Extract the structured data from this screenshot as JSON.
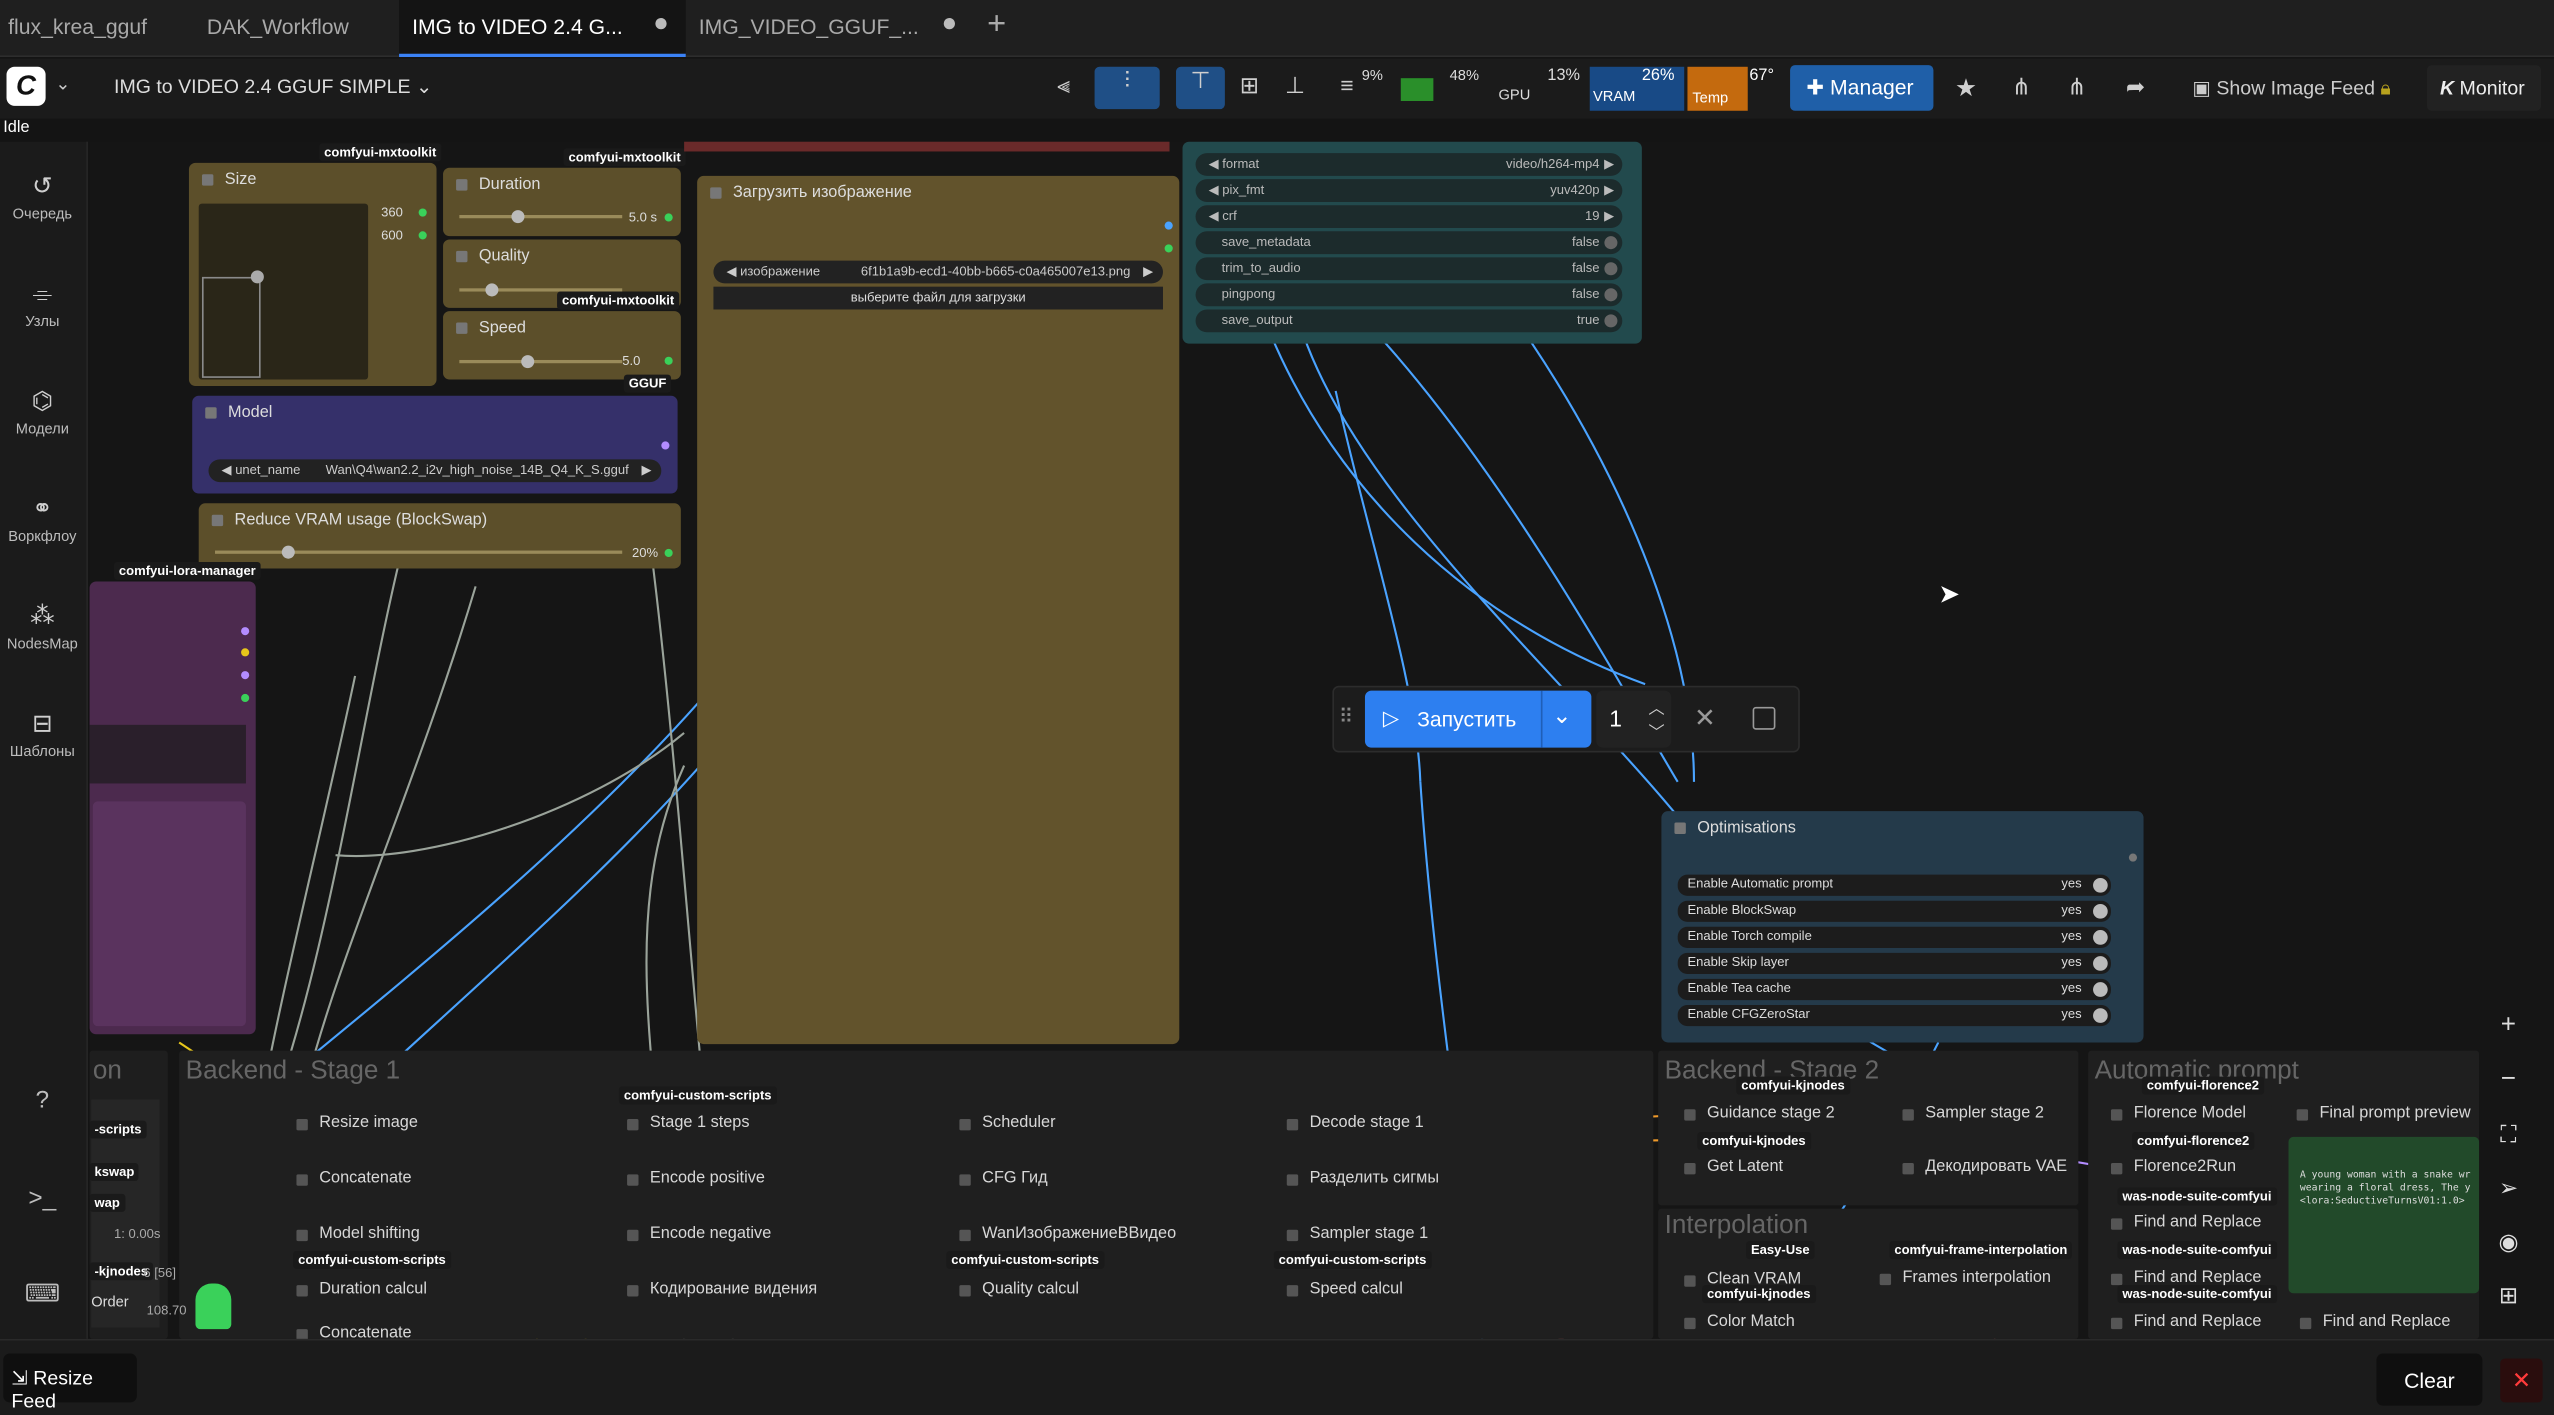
{
  "tabs": [
    {
      "label": "flux_krea_gguf"
    },
    {
      "label": "DAK_Workflow"
    },
    {
      "label": "IMG to VIDEO 2.4 G...",
      "active": true
    },
    {
      "label": "IMG_VIDEO_GGUF_..."
    }
  ],
  "menubar": {
    "workflow_name": "IMG to VIDEO 2.4 GGUF SIMPLE",
    "stats": {
      "cpu": "9%",
      "ram": "48%",
      "gpu_label": "GPU",
      "gpu": "13%",
      "vram_label": "VRAM",
      "vram": "26%",
      "temp_label": "Temp",
      "temp": "67°"
    },
    "manager_label": "Manager",
    "show_image_feed": "Show Image Feed",
    "monitor_label": "Monitor"
  },
  "status": "Idle",
  "sidebar": [
    {
      "label": "Очередь",
      "icon": "history-icon"
    },
    {
      "label": "Узлы",
      "icon": "nodes-icon"
    },
    {
      "label": "Модели",
      "icon": "models-icon"
    },
    {
      "label": "Воркфлоу",
      "icon": "workflow-icon"
    },
    {
      "label": "NodesMap",
      "icon": "nodesmap-icon"
    },
    {
      "label": "Шаблоны",
      "icon": "templates-icon"
    }
  ],
  "nodes": {
    "size": {
      "title": "Size",
      "w": "360",
      "h": "600",
      "tag": "comfyui-mxtoolkit"
    },
    "duration": {
      "title": "Duration",
      "value": "5.0 s",
      "tag": "comfyui-mxtoolkit"
    },
    "quality": {
      "title": "Quality",
      "tag": "comfyui-mxtoolkit"
    },
    "speed": {
      "title": "Speed",
      "value": "5.0",
      "tag": "GGUF"
    },
    "model": {
      "title": "Model",
      "unet_label": "unet_name",
      "unet_value": "Wan\\Q4\\wan2.2_i2v_high_noise_14B_Q4_K_S.gguf"
    },
    "blockswap": {
      "title": "Reduce VRAM usage (BlockSwap)",
      "value": "20%"
    },
    "lora_tag": "comfyui-lora-manager",
    "load_image": {
      "title": "Загрузить изображение",
      "image_label": "изображение",
      "image_value": "6f1b1a9b-ecd1-40bb-b665-c0a465007e13.png",
      "upload_label": "выберите файл для загрузки"
    },
    "video": {
      "widgets": [
        {
          "label": "format",
          "value": "video/h264-mp4",
          "arrows": true
        },
        {
          "label": "pix_fmt",
          "value": "yuv420p",
          "arrows": true
        },
        {
          "label": "crf",
          "value": "19",
          "arrows": true
        },
        {
          "label": "save_metadata",
          "value": "false"
        },
        {
          "label": "trim_to_audio",
          "value": "false"
        },
        {
          "label": "pingpong",
          "value": "false"
        },
        {
          "label": "save_output",
          "value": "true"
        }
      ]
    },
    "optimisations": {
      "title": "Optimisations",
      "items": [
        {
          "label": "Enable Automatic prompt",
          "value": "yes"
        },
        {
          "label": "Enable BlockSwap",
          "value": "yes"
        },
        {
          "label": "Enable Torch compile",
          "value": "yes"
        },
        {
          "label": "Enable Skip layer",
          "value": "yes"
        },
        {
          "label": "Enable Tea cache",
          "value": "yes"
        },
        {
          "label": "Enable CFGZeroStar",
          "value": "yes"
        }
      ]
    }
  },
  "run": {
    "label": "Запустить",
    "count": "1"
  },
  "groups": {
    "stage1": "Backend - Stage 1",
    "stage2": "Backend - Stage 2",
    "interpolation": "Interpolation",
    "auto_prompt": "Automatic prompt",
    "left_partial": "on"
  },
  "bottom_nodes": [
    {
      "label": "Resize image",
      "id": "n1"
    },
    {
      "label": "Concatenate",
      "id": "n2"
    },
    {
      "label": "Model shifting",
      "id": "n3"
    },
    {
      "label": "Duration calcul",
      "id": "n4"
    },
    {
      "label": "Concatenate",
      "id": "n5"
    },
    {
      "label": "Stage 1 steps",
      "id": "n6"
    },
    {
      "label": "Encode positive",
      "id": "n7"
    },
    {
      "label": "Encode negative",
      "id": "n8"
    },
    {
      "label": "Кодирование видения",
      "id": "n9"
    },
    {
      "label": "Scheduler",
      "id": "n10"
    },
    {
      "label": "CFG Гид",
      "id": "n11"
    },
    {
      "label": "WanИзображениеВВидео",
      "id": "n12"
    },
    {
      "label": "Quality calcul",
      "id": "n13"
    },
    {
      "label": "Decode stage 1",
      "id": "n14"
    },
    {
      "label": "Разделить сигмы",
      "id": "n15"
    },
    {
      "label": "Sampler stage 1",
      "id": "n16"
    },
    {
      "label": "Speed calcul",
      "id": "n17"
    },
    {
      "label": "Guidance stage 2",
      "id": "n18"
    },
    {
      "label": "Get Latent",
      "id": "n19"
    },
    {
      "label": "Sampler stage 2",
      "id": "n20"
    },
    {
      "label": "Декодировать VAE",
      "id": "n21"
    },
    {
      "label": "Clean VRAM",
      "id": "n22"
    },
    {
      "label": "Frames interpolation",
      "id": "n23"
    },
    {
      "label": "Color Match",
      "id": "n24"
    },
    {
      "label": "Florence Model",
      "id": "n25"
    },
    {
      "label": "Florence2Run",
      "id": "n26"
    },
    {
      "label": "Find and Replace",
      "id": "n27"
    },
    {
      "label": "Find and Replace",
      "id": "n28"
    },
    {
      "label": "Find and Replace",
      "id": "n29"
    },
    {
      "label": "Find and Replace",
      "id": "n30"
    },
    {
      "label": "Final prompt preview",
      "id": "n31"
    }
  ],
  "bottom_tags": [
    {
      "label": "comfyui-custom-scripts",
      "id": "t1"
    },
    {
      "label": "comfyui-custom-scripts",
      "id": "t2"
    },
    {
      "label": "comfyui-custom-scripts",
      "id": "t3"
    },
    {
      "label": "comfyui-custom-scripts",
      "id": "t4"
    },
    {
      "label": "comfyui-kjnodes",
      "id": "t5"
    },
    {
      "label": "comfyui-kjnodes",
      "id": "t6"
    },
    {
      "label": "comfyui-kjnodes",
      "id": "t7"
    },
    {
      "label": "Easy-Use",
      "id": "t8"
    },
    {
      "label": "comfyui-frame-interpolation",
      "id": "t9"
    },
    {
      "label": "comfyui-florence2",
      "id": "t10"
    },
    {
      "label": "comfyui-florence2",
      "id": "t11"
    },
    {
      "label": "was-node-suite-comfyui",
      "id": "t12"
    },
    {
      "label": "was-node-suite-comfyui",
      "id": "t13"
    },
    {
      "label": "was-node-suite-comfyui",
      "id": "t14"
    }
  ],
  "left_fragments": {
    "scripts": "-scripts",
    "kswap": "kswap",
    "wap": "wap",
    "nodes": "-kjnodes",
    "order": "Order",
    "time": "1: 0.00s",
    "bracket": "6 [56]",
    "num": "108.70"
  },
  "prompt_preview": "A young woman with a snake wr wearing a floral dress, The y <lora:SeductiveTurnsV01:1.0>",
  "bottombar": {
    "resize_feed": "Resize Feed",
    "clear": "Clear"
  }
}
